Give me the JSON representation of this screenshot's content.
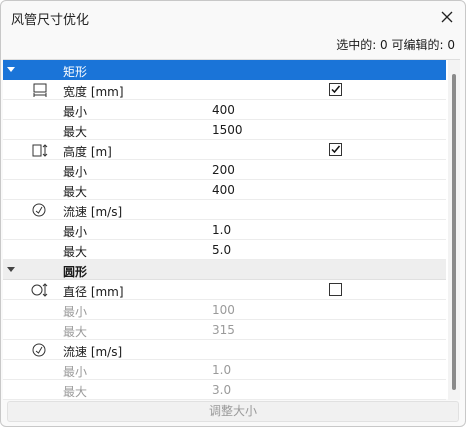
{
  "window": {
    "title": "风管尺寸优化"
  },
  "status": {
    "text": "选中的: 0 可编辑的: 0"
  },
  "categories": {
    "rect": {
      "label": "矩形"
    },
    "round": {
      "label": "圆形"
    }
  },
  "props": {
    "width": {
      "label": "宽度 [mm]",
      "checked": true,
      "min_label": "最小",
      "min": "400",
      "max_label": "最大",
      "max": "1500"
    },
    "height": {
      "label": "高度 [m]",
      "checked": true,
      "min_label": "最小",
      "min": "200",
      "max_label": "最大",
      "max": "400"
    },
    "velocity_rect": {
      "label": "流速 [m/s]",
      "min_label": "最小",
      "min": "1.0",
      "max_label": "最大",
      "max": "5.0"
    },
    "diameter": {
      "label": "直径 [mm]",
      "checked": false,
      "min_label": "最小",
      "min": "100",
      "max_label": "最大",
      "max": "315"
    },
    "velocity_round": {
      "label": "流速 [m/s]",
      "min_label": "最小",
      "min": "1.0",
      "max_label": "最大",
      "max": "3.0"
    }
  },
  "buttons": {
    "resize": "调整大小"
  },
  "icons": {
    "close": "close-icon",
    "collapse": "caret-down-icon",
    "width": "width-dimension-icon",
    "height": "height-dimension-icon",
    "velocity": "gauge-icon",
    "diameter": "diameter-icon"
  },
  "colors": {
    "selection": "#1a74d8",
    "category_bg": "#eeeeee",
    "disabled_text": "#9a9a9a"
  }
}
